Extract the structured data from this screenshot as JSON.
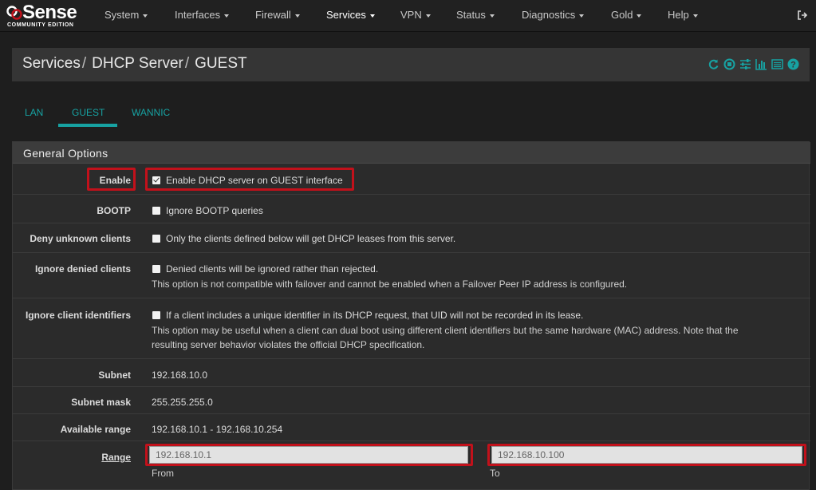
{
  "logo": {
    "word": "Sense",
    "edition": "COMMUNITY EDITION"
  },
  "nav": {
    "items": [
      {
        "label": "System"
      },
      {
        "label": "Interfaces"
      },
      {
        "label": "Firewall"
      },
      {
        "label": "Services"
      },
      {
        "label": "VPN"
      },
      {
        "label": "Status"
      },
      {
        "label": "Diagnostics"
      },
      {
        "label": "Gold"
      },
      {
        "label": "Help"
      }
    ],
    "active": "Services"
  },
  "breadcrumb": {
    "part1": "Services",
    "part2": "DHCP Server",
    "part3": "GUEST"
  },
  "header_icons": [
    "reload-icon",
    "stop-icon",
    "sliders-icon",
    "chart-icon",
    "list-icon",
    "help-icon"
  ],
  "tabs": [
    {
      "label": "LAN"
    },
    {
      "label": "GUEST"
    },
    {
      "label": "WANNIC"
    }
  ],
  "active_tab": "GUEST",
  "panel": {
    "title": "General Options"
  },
  "fields": {
    "enable": {
      "label": "Enable",
      "checkbox_text": "Enable DHCP server on GUEST interface",
      "checked": true
    },
    "bootp": {
      "label": "BOOTP",
      "checkbox_text": "Ignore BOOTP queries",
      "checked": false
    },
    "deny_unknown": {
      "label": "Deny unknown clients",
      "checkbox_text": "Only the clients defined below will get DHCP leases from this server.",
      "checked": false
    },
    "ignore_denied": {
      "label": "Ignore denied clients",
      "checkbox_text": "Denied clients will be ignored rather than rejected.",
      "help": "This option is not compatible with failover and cannot be enabled when a Failover Peer IP address is configured.",
      "checked": false
    },
    "ignore_client_id": {
      "label": "Ignore client identifiers",
      "checkbox_text": "If a client includes a unique identifier in its DHCP request, that UID will not be recorded in its lease.",
      "help_line1": "This option may be useful when a client can dual boot using different client identifiers but the same hardware (MAC) address. Note that the",
      "help_line2": "resulting server behavior violates the official DHCP specification.",
      "checked": false
    },
    "subnet": {
      "label": "Subnet",
      "value": "192.168.10.0"
    },
    "subnet_mask": {
      "label": "Subnet mask",
      "value": "255.255.255.0"
    },
    "available_range": {
      "label": "Available range",
      "value": "192.168.10.1 - 192.168.10.254"
    },
    "range": {
      "label": "Range",
      "from_value": "192.168.10.1",
      "from_label": "From",
      "to_value": "192.168.10.100",
      "to_label": "To"
    }
  },
  "colors": {
    "accent": "#17a2a2",
    "highlight": "#c2111b",
    "navbar": "#212121"
  }
}
